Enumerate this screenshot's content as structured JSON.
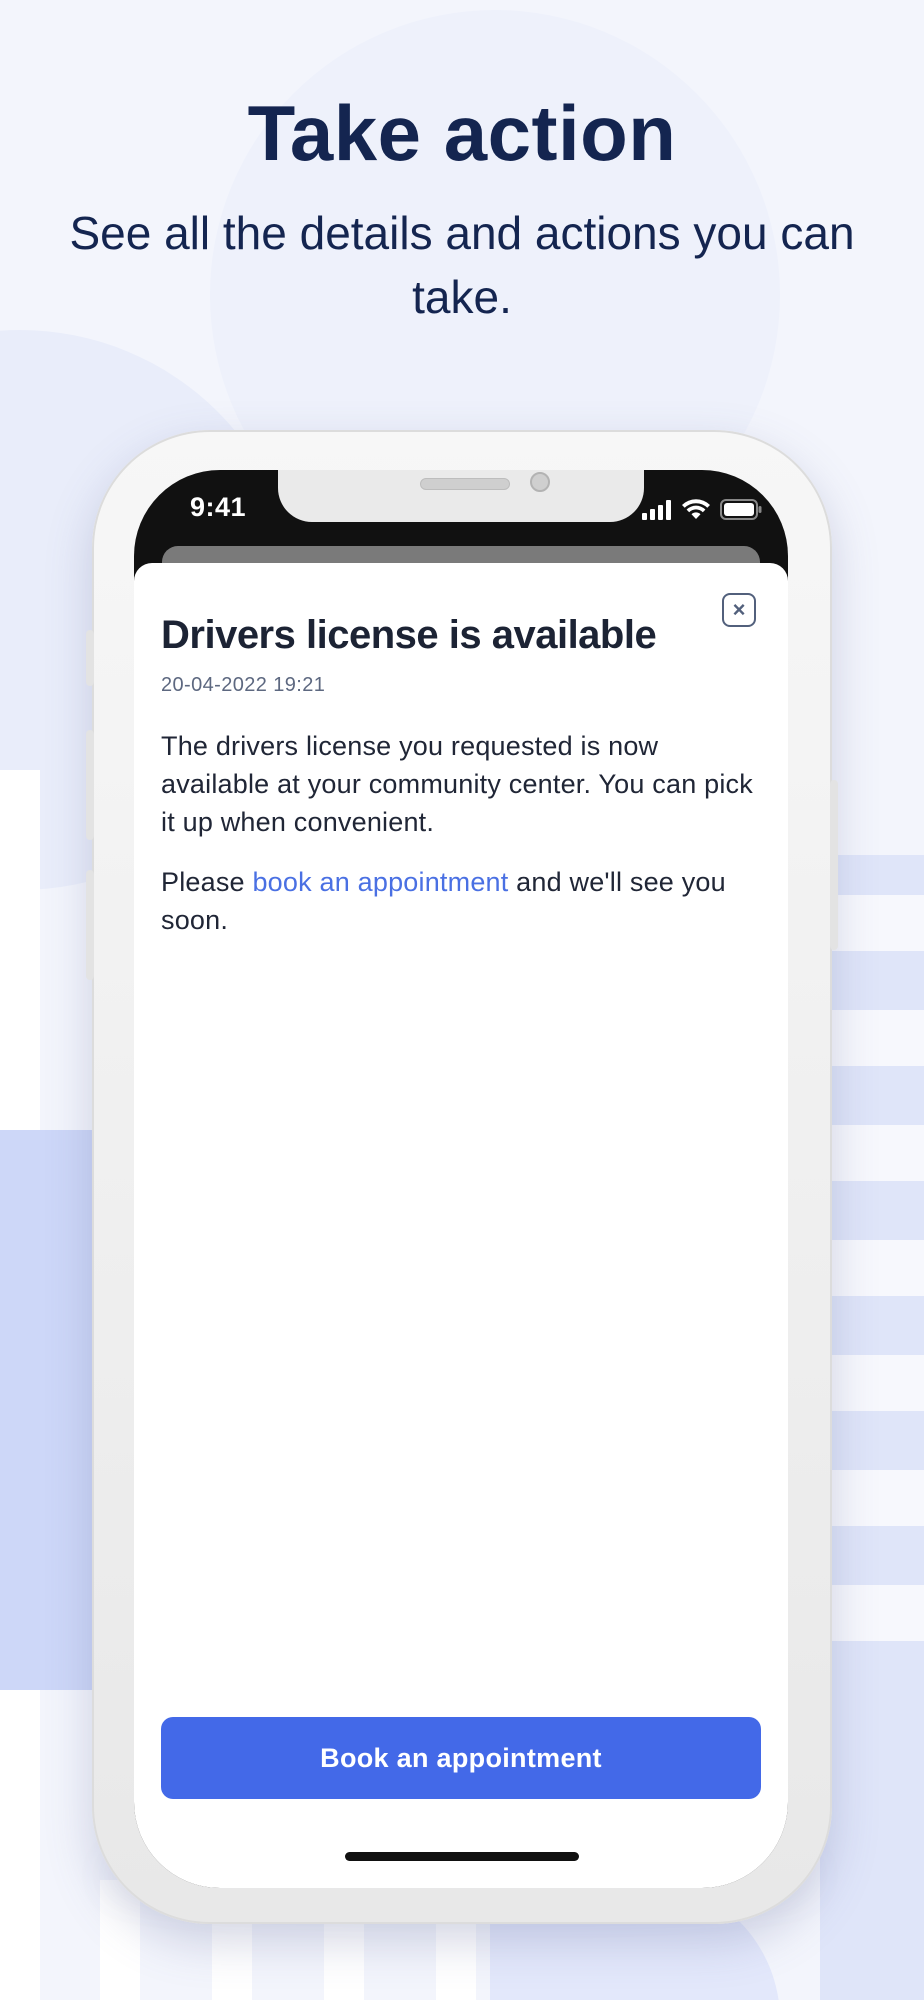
{
  "hero": {
    "title": "Take action",
    "subtitle": "See all the details and actions you can take."
  },
  "status_bar": {
    "time": "9:41",
    "icons": [
      "cellular-signal-icon",
      "wifi-icon",
      "battery-icon"
    ]
  },
  "notification": {
    "close_icon": "×",
    "title": "Drivers license is available",
    "timestamp": "20-04-2022 19:21",
    "paragraph_1": "The drivers license you requested is now available at your community center. You can pick it up when convenient.",
    "paragraph_2_prefix": "Please ",
    "paragraph_2_link": "book an appointment",
    "paragraph_2_suffix": " and we'll see you soon.",
    "primary_button": "Book an appointment"
  },
  "colors": {
    "background": "#f3f5fc",
    "heading": "#142550",
    "accent": "#4369e8",
    "link": "#4a70e3"
  }
}
